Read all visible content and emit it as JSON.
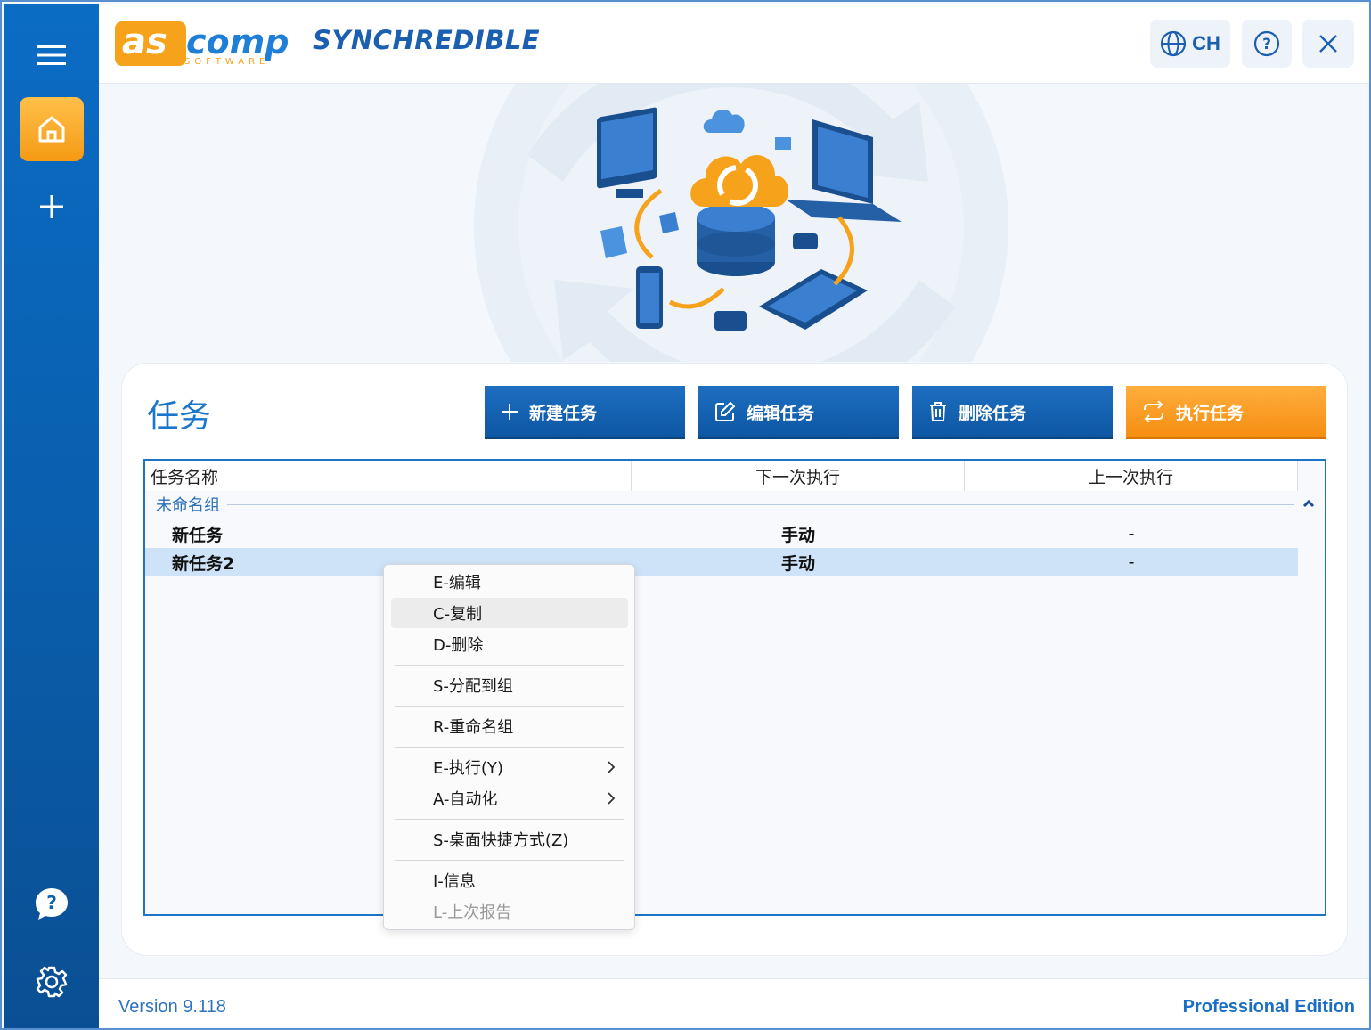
{
  "header": {
    "logo_text": "ascomp",
    "logo_sub": "SOFTWARE",
    "product_name": "SYNCHREDIBLE",
    "language_label": "CH"
  },
  "icons": {
    "menu": "menu-icon",
    "home": "home-icon",
    "add": "plus-icon",
    "help_chat": "chat-help-icon",
    "settings": "gear-icon",
    "globe": "globe-icon",
    "help": "question-icon",
    "close": "close-icon"
  },
  "colors": {
    "sidebar": "#0b6cc4",
    "accent_orange": "#f59a14",
    "primary_blue": "#1b5fb0",
    "selection": "#cfe3f8"
  },
  "tasks": {
    "title": "任务",
    "buttons": {
      "new": "新建任务",
      "edit": "编辑任务",
      "delete": "删除任务",
      "run": "执行任务"
    },
    "columns": [
      "任务名称",
      "下一次执行",
      "上一次执行"
    ],
    "group": "未命名组",
    "rows": [
      {
        "name": "新任务",
        "next": "手动",
        "last": "-"
      },
      {
        "name": "新任务2",
        "next": "手动",
        "last": "-"
      }
    ]
  },
  "context_menu": {
    "items": [
      {
        "label": "E-编辑"
      },
      {
        "label": "C-复制"
      },
      {
        "label": "D-删除"
      },
      {
        "label": "S-分配到组"
      },
      {
        "label": "R-重命名组"
      },
      {
        "label": "E-执行(Y)"
      },
      {
        "label": "A-自动化"
      },
      {
        "label": "S-桌面快捷方式(Z)"
      },
      {
        "label": "I-信息"
      },
      {
        "label": "L-上次报告"
      }
    ]
  },
  "footer": {
    "version": "Version 9.118",
    "edition": "Professional Edition"
  }
}
